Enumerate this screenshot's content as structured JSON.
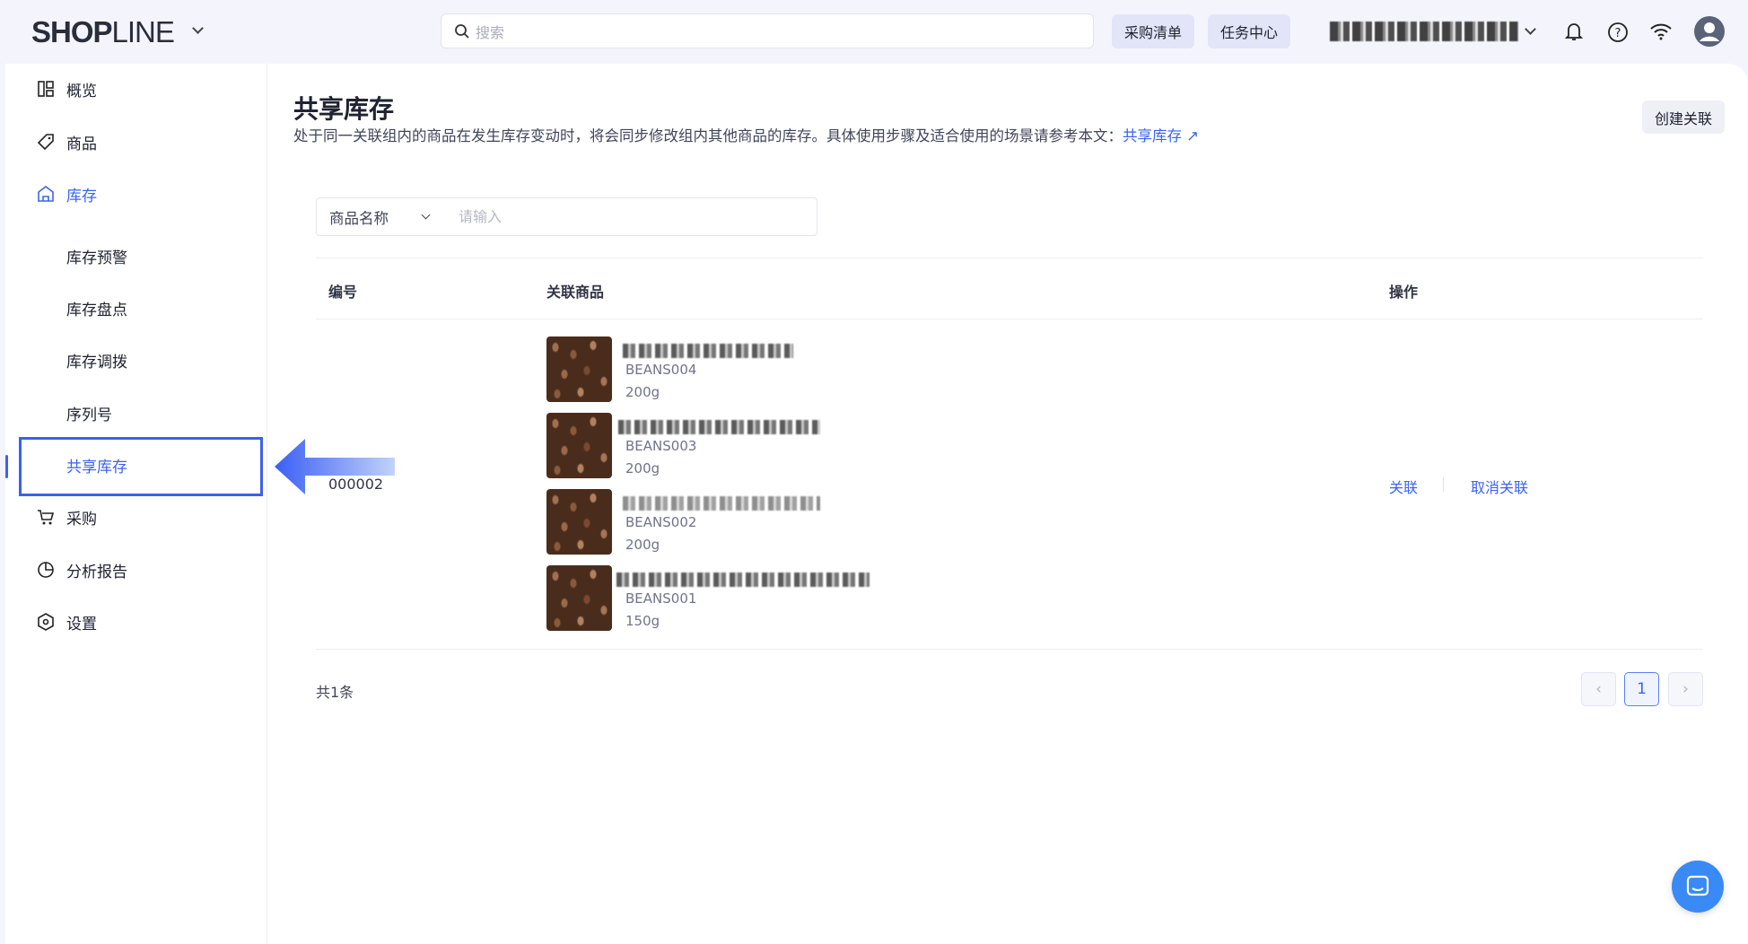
{
  "header": {
    "logo_text": "SHOPLINE",
    "search_placeholder": "搜索",
    "purchase_list": "采购清单",
    "task_center": "任务中心"
  },
  "sidebar": {
    "items": [
      {
        "label": "概览",
        "icon": "dashboard-icon"
      },
      {
        "label": "商品",
        "icon": "tag-icon"
      },
      {
        "label": "库存",
        "icon": "warehouse-icon"
      },
      {
        "label": "库存预警"
      },
      {
        "label": "库存盘点"
      },
      {
        "label": "库存调拨"
      },
      {
        "label": "序列号"
      },
      {
        "label": "共享库存"
      },
      {
        "label": "采购",
        "icon": "cart-icon"
      },
      {
        "label": "分析报告",
        "icon": "pie-chart-icon"
      },
      {
        "label": "设置",
        "icon": "settings-icon"
      }
    ]
  },
  "page": {
    "title": "共享库存",
    "description": "处于同一关联组内的商品在发生库存变动时，将会同步修改组内其他商品的库存。具体使用步骤及适合使用的场景请参考本文：",
    "help_link": "共享库存",
    "create_button": "创建关联"
  },
  "filter": {
    "field": "商品名称",
    "placeholder": "请输入"
  },
  "table": {
    "headers": [
      "编号",
      "关联商品",
      "操作"
    ],
    "rows": [
      {
        "id": "000002",
        "products": [
          {
            "code": "BEANS004",
            "weight": "200g"
          },
          {
            "code": "BEANS003",
            "weight": "200g"
          },
          {
            "code": "BEANS002",
            "weight": "200g"
          },
          {
            "code": "BEANS001",
            "weight": "150g"
          }
        ],
        "actions": [
          "关联",
          "取消关联"
        ]
      }
    ]
  },
  "footer": {
    "total": "共1条",
    "current_page": "1"
  },
  "colors": {
    "accent": "#3a63f0",
    "highlight_border": "#3a5ff3"
  }
}
